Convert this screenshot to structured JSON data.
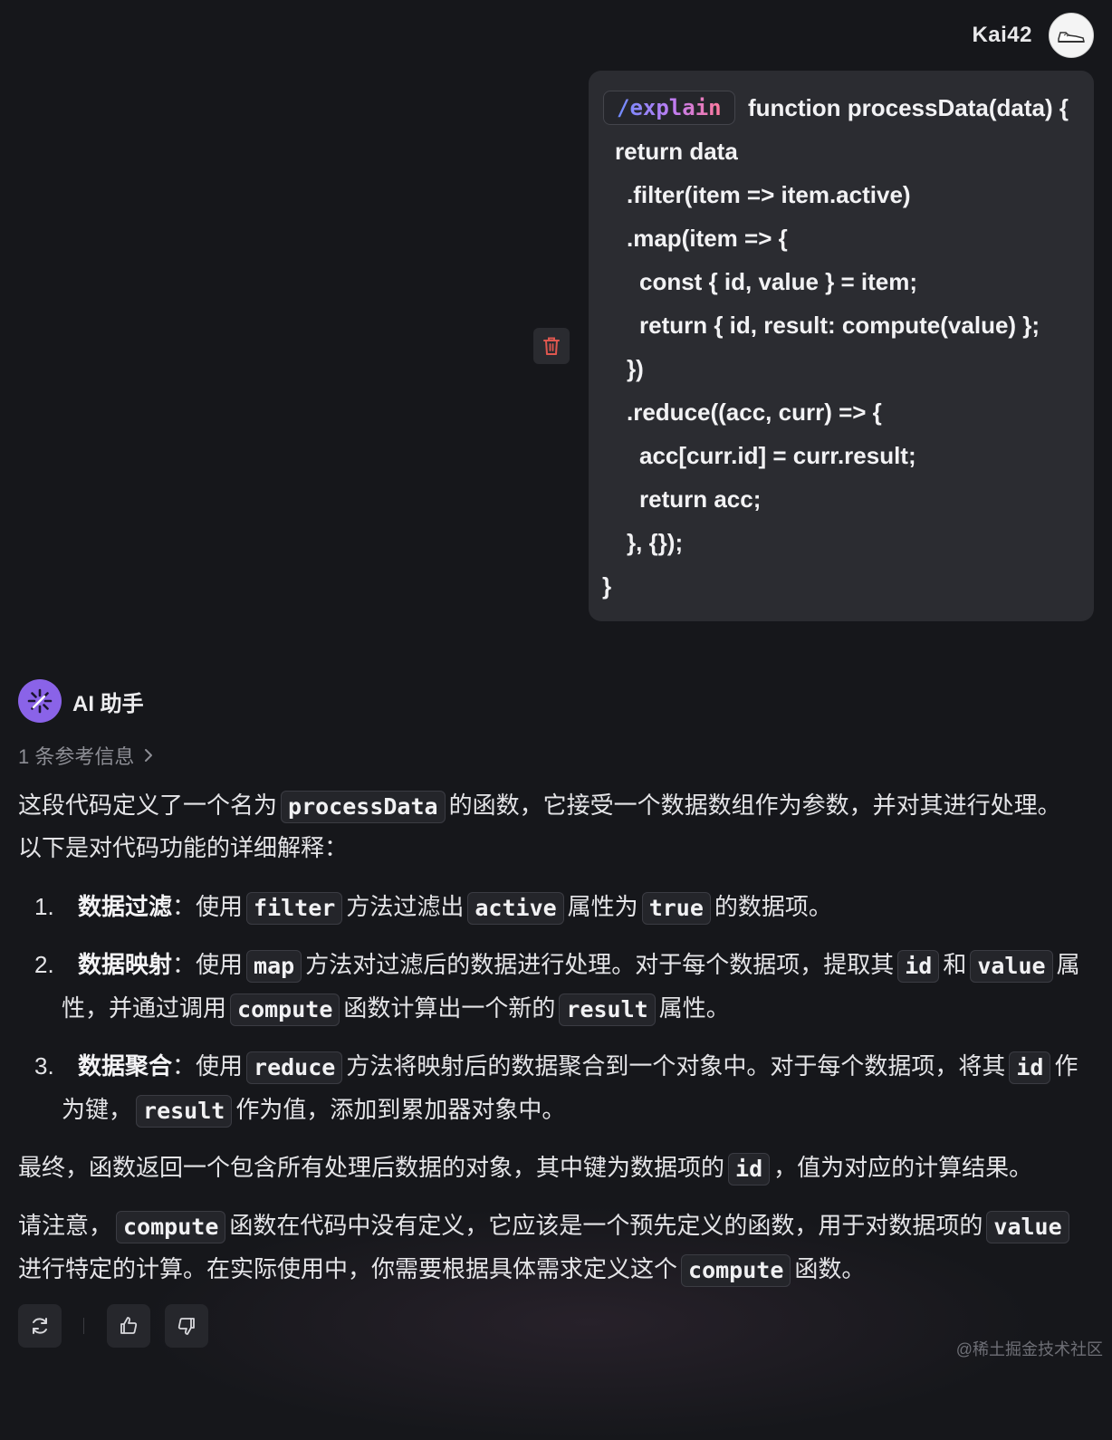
{
  "user": {
    "name": "Kai42",
    "avatar_icon": "sneaker-avatar-icon"
  },
  "message": {
    "command": "/explain",
    "code_lines": [
      "function processData(data) {",
      "return data",
      ".filter(item => item.active)",
      ".map(item => {",
      "const { id, value } = item;",
      "return { id, result: compute(value) };",
      "})",
      ".reduce((acc, curr) => {",
      "acc[curr.id] = curr.result;",
      "return acc;",
      "}, {});",
      "}"
    ],
    "delete_icon": "trash-icon"
  },
  "assistant": {
    "name": "AI 助手",
    "references": "1 条参考信息",
    "intro": {
      "a": "这段代码定义了一个名为",
      "code": "processData",
      "b": "的函数，它接受一个数据数组作为参数，并对其进行处理。",
      "line2": "以下是对代码功能的详细解释："
    },
    "items": [
      {
        "num": "1.",
        "title": "数据过滤",
        "l1": {
          "a": "：使用",
          "c1": "filter",
          "b": "方法过滤出",
          "c2": "active",
          "c": "属性为",
          "c3": "true",
          "d": "的数据项。"
        }
      },
      {
        "num": "2.",
        "title": "数据映射",
        "l1": {
          "a": "：使用",
          "c1": "map",
          "b": "方法对过滤后的数据进行处理。对于每个数据项，提取其",
          "c2": "id",
          "c": "和",
          "c3": "value",
          "d": "属"
        },
        "l2": {
          "a": "性，并通过调用",
          "c1": "compute",
          "b": "函数计算出一个新的",
          "c2": "result",
          "c": "属性。"
        }
      },
      {
        "num": "3.",
        "title": "数据聚合",
        "l1": {
          "a": "：使用",
          "c1": "reduce",
          "b": "方法将映射后的数据聚合到一个对象中。对于每个数据项，将其",
          "c2": "id",
          "c": "作"
        },
        "l2": {
          "a": "为键，",
          "c1": "result",
          "b": "作为值，添加到累加器对象中。"
        }
      }
    ],
    "final": {
      "a": "最终，函数返回一个包含所有处理后数据的对象，其中键为数据项的",
      "code": "id",
      "b": "，值为对应的计算结果。"
    },
    "note": {
      "l1": {
        "a": "请注意，",
        "c1": "compute",
        "b": "函数在代码中没有定义，它应该是一个预先定义的函数，用于对数据项的",
        "c2": "value"
      },
      "l2": {
        "a": "进行特定的计算。在实际使用中，你需要根据具体需求定义这个",
        "c1": "compute",
        "b": "函数。"
      }
    }
  },
  "actions": {
    "regenerate_icon": "refresh-icon",
    "like_icon": "thumbs-up-icon",
    "dislike_icon": "thumbs-down-icon"
  },
  "watermark": "@稀土掘金技术社区",
  "colors": {
    "background": "#16171b",
    "bubble": "#2b2c31",
    "ai_avatar": "#8a63e8",
    "delete_red": "#e0574f"
  }
}
